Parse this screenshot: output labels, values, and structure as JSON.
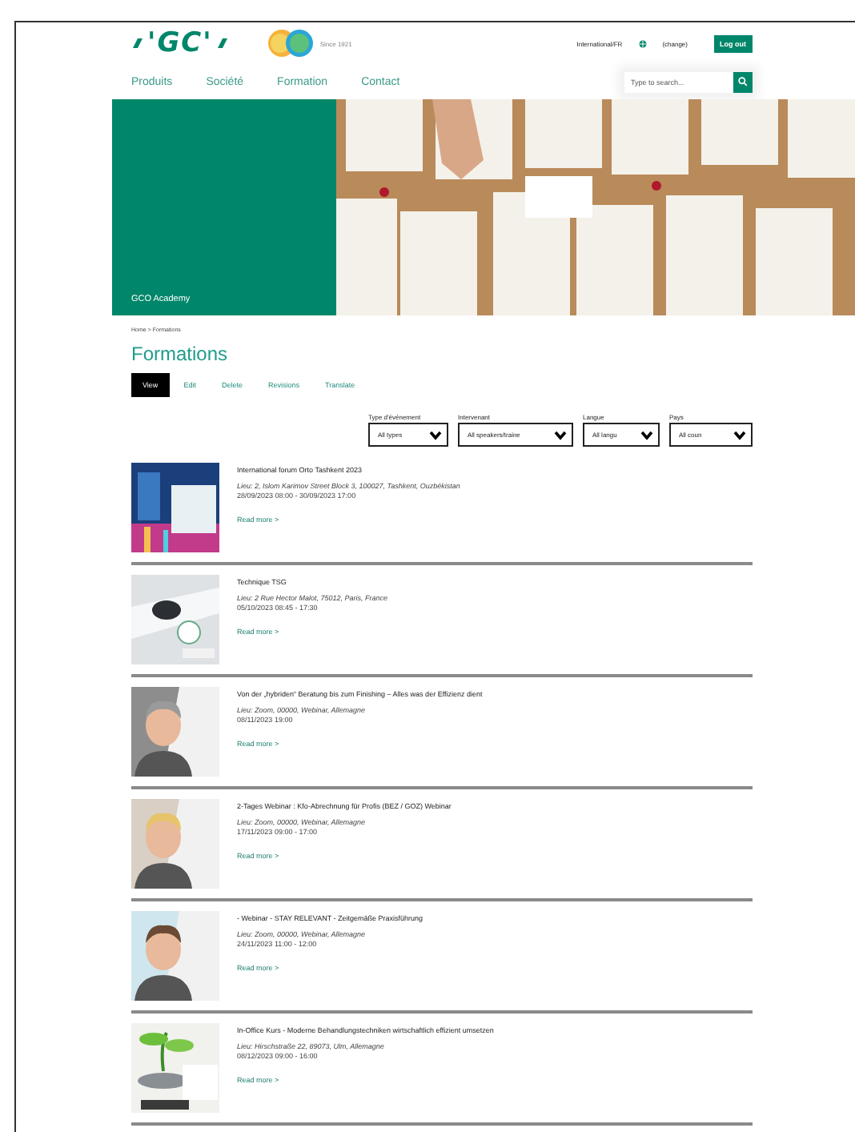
{
  "header": {
    "logo": "'GC'",
    "anniversary_note": "Since 1921",
    "region": "International/FR",
    "change_link": "(change)",
    "logout": "Log out",
    "search": {
      "placeholder": "Type to search..."
    }
  },
  "nav": [
    "Produits",
    "Société",
    "Formation",
    "Contact"
  ],
  "hero": {
    "title": "GCO Academy"
  },
  "breadcrumb": {
    "items": [
      "Home",
      "Formations"
    ],
    "separator": ">"
  },
  "title": "Formations",
  "tabs": [
    {
      "label": "View",
      "selected": true
    },
    {
      "label": "Edit",
      "selected": false
    },
    {
      "label": "Delete",
      "selected": false
    },
    {
      "label": "Revisions",
      "selected": false
    },
    {
      "label": "Translate",
      "selected": false
    }
  ],
  "filters": [
    {
      "label": "Type d'événement",
      "value": "All types"
    },
    {
      "label": "Intervenant",
      "value": "All speakers/traine"
    },
    {
      "label": "Langue",
      "value": "All langu"
    },
    {
      "label": "Pays",
      "value": "All coun"
    }
  ],
  "events": [
    {
      "title": "International forum Orto Tashkent 2023",
      "location": "Lieu: 2, Islom Karimov Street Block 3, 100027, Tashkent, Ouzbékistan",
      "date": "28/09/2023 08:00 - 30/09/2023 17:00",
      "link": "Read more >"
    },
    {
      "title": "Technique TSG",
      "location": "Lieu: 2 Rue Hector Malot, 75012, Paris, France",
      "date": "05/10/2023 08:45 - 17:30",
      "link": "Read more >"
    },
    {
      "title": "Von der „hybriden“ Beratung bis zum Finishing – Alles was der Effizienz dient",
      "location": "Lieu: Zoom, 00000, Webinar, Allemagne",
      "date": "08/11/2023 19:00",
      "link": "Read more >"
    },
    {
      "title": "2-Tages Webinar : Kfo-Abrechnung für Profis (BEZ / GOZ) Webinar",
      "location": "Lieu: Zoom, 00000, Webinar, Allemagne",
      "date": "17/11/2023 09:00 - 17:00",
      "link": "Read more >"
    },
    {
      "title": "- Webinar - STAY RELEVANT - Zeitgemäße Praxisführung",
      "location": "Lieu: Zoom, 00000, Webinar, Allemagne",
      "date": "24/11/2023 11:00 - 12:00",
      "link": "Read more >"
    },
    {
      "title": "In-Office Kurs - Moderne Behandlungstechniken wirtschaftlich effizient umsetzen",
      "location": "Lieu: Hirschstraße 22, 89073, Ulm, Allemagne",
      "date": "08/12/2023 09:00 - 16:00",
      "link": "Read more >"
    }
  ]
}
